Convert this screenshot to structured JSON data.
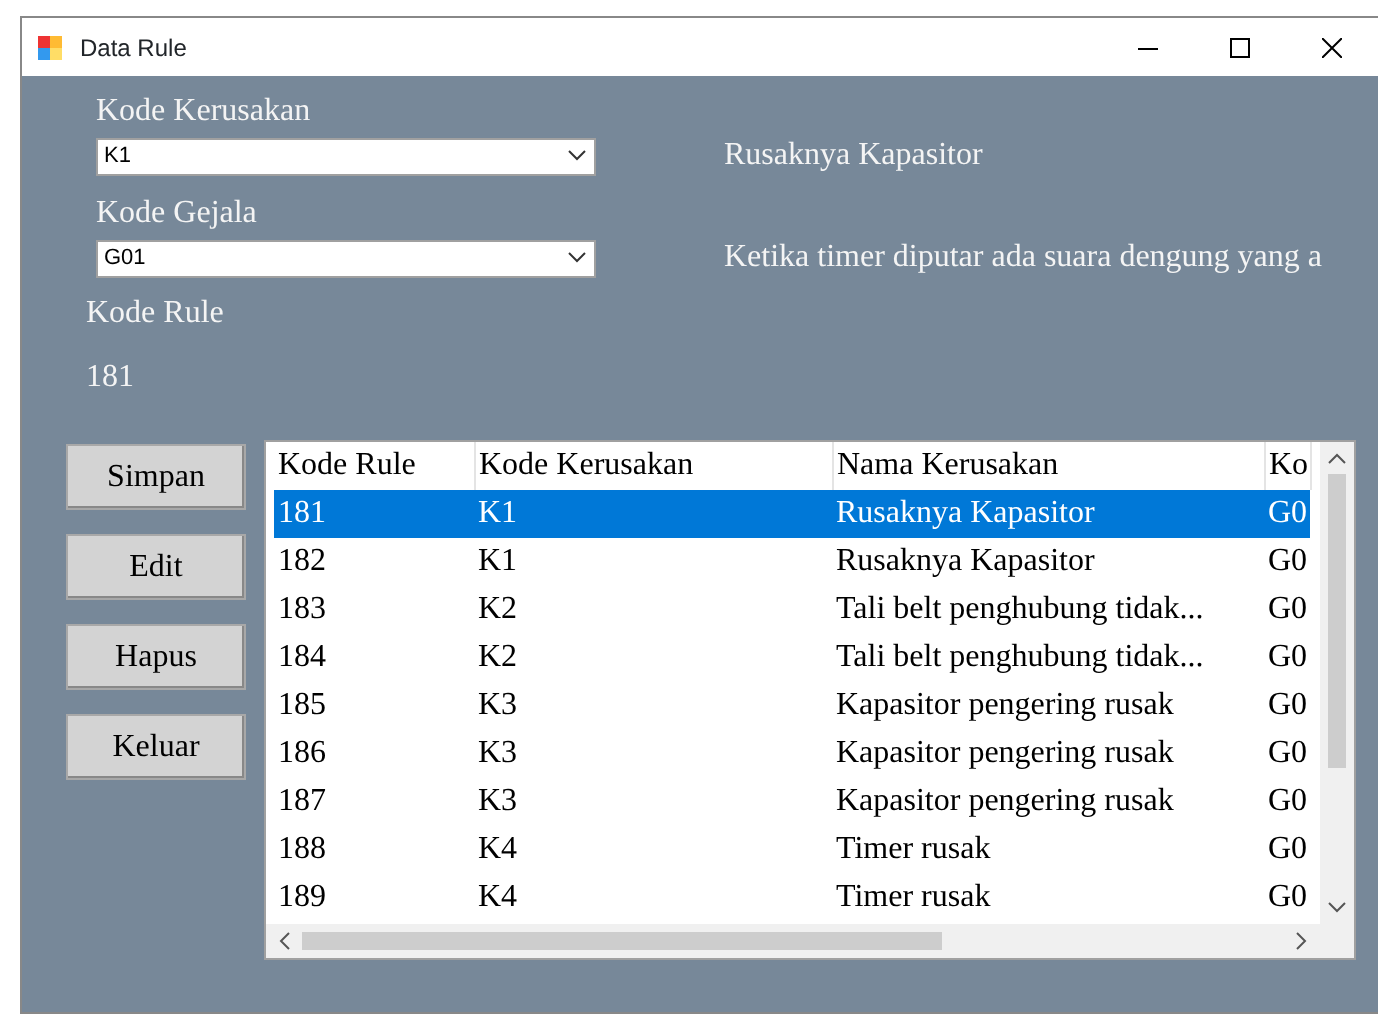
{
  "window": {
    "title": "Data Rule"
  },
  "fields": [
    {
      "label": "Kode Kerusakan",
      "value": "K1",
      "description": "Rusaknya Kapasitor"
    },
    {
      "label": "Kode Gejala",
      "value": "G01",
      "description": "Ketika timer diputar ada suara dengung yang a"
    }
  ],
  "rule": {
    "label": "Kode Rule",
    "value": "181"
  },
  "buttons": [
    "Simpan",
    "Edit",
    "Hapus",
    "Keluar"
  ],
  "table": {
    "columns": [
      "Kode Rule",
      "Kode Kerusakan",
      "Nama Kerusakan",
      "Ko"
    ],
    "rows": [
      {
        "cells": [
          "181",
          "K1",
          "Rusaknya Kapasitor",
          "G0"
        ],
        "selected": true
      },
      {
        "cells": [
          "182",
          "K1",
          "Rusaknya Kapasitor",
          "G0"
        ],
        "selected": false
      },
      {
        "cells": [
          "183",
          "K2",
          "Tali belt penghubung tidak...",
          "G0"
        ],
        "selected": false
      },
      {
        "cells": [
          "184",
          "K2",
          "Tali belt penghubung tidak...",
          "G0"
        ],
        "selected": false
      },
      {
        "cells": [
          "185",
          "K3",
          "Kapasitor pengering rusak",
          "G0"
        ],
        "selected": false
      },
      {
        "cells": [
          "186",
          "K3",
          "Kapasitor pengering rusak",
          "G0"
        ],
        "selected": false
      },
      {
        "cells": [
          "187",
          "K3",
          "Kapasitor pengering rusak",
          "G0"
        ],
        "selected": false
      },
      {
        "cells": [
          "188",
          "K4",
          "Timer rusak",
          "G0"
        ],
        "selected": false
      },
      {
        "cells": [
          "189",
          "K4",
          "Timer rusak",
          "G0"
        ],
        "selected": false
      }
    ]
  }
}
